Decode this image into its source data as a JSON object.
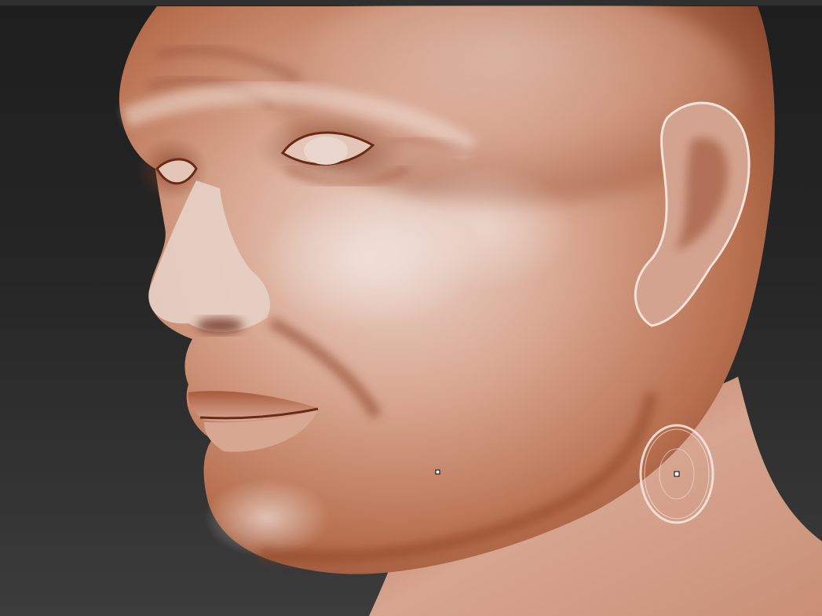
{
  "app": {
    "window_title": ""
  },
  "canvas": {
    "background_top": "#1e1e1e",
    "background_bottom": "#3c3c3c",
    "material_color": "#c98a6c",
    "material_highlight": "#e8cfc4",
    "material_shadow": "#7a3a22"
  },
  "brush": {
    "icon": "brush-cursor-icon",
    "ring_color": "#f2e6e0"
  },
  "pivot": {
    "icon": "pivot-point-icon"
  }
}
